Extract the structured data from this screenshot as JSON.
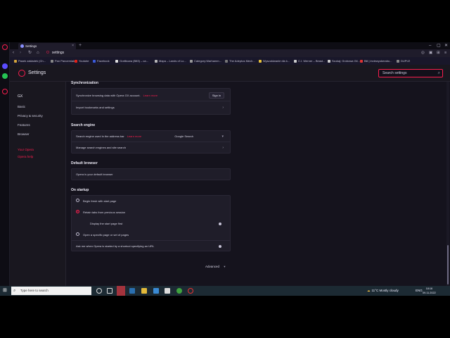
{
  "browser": {
    "tab_title": "Settings",
    "address": "settings",
    "bookmarks": [
      "Pasek zakładek (Ch...",
      "Pan Pancerniak",
      "Youtube",
      "Facebook",
      "Grafikowa (B83) – ca...",
      "Mapa – Lands of Lo...",
      "Category:Warhamm...",
      "The Adeptus Mech...",
      "Wyszukiwanie dla k...",
      "C.I. Werner – Beast...",
      "Szukaj: Grobowa Gil...",
      "Bill | inviewyokerabu...",
      "DUPLE"
    ]
  },
  "settings": {
    "page_title": "Settings",
    "search_placeholder": "Search settings",
    "nav": {
      "section": "GX",
      "items": [
        "Basic",
        "Privacy & security",
        "Features",
        "Browser"
      ],
      "links": [
        "Your Opera",
        "Opera help"
      ]
    },
    "synchronization": {
      "title": "Synchronization",
      "sync_text": "Synchronize browsing data with Opera GX account.",
      "learn_more": "Learn more",
      "sign_in": "Sign in",
      "import": "Import bookmarks and settings"
    },
    "search_engine": {
      "title": "Search engine",
      "label": "Search engine used in the address bar",
      "learn_more": "Learn more",
      "value": "Google Search",
      "manage": "Manage search engines and site search"
    },
    "default_browser": {
      "title": "Default browser",
      "text": "Opera is your default browser"
    },
    "on_startup": {
      "title": "On startup",
      "opt_fresh": "Begin fresh with start page",
      "opt_retain": "Retain tabs from previous session",
      "sub_display": "Display the start page first",
      "opt_specific": "Open a specific page or set of pages",
      "ask": "Ask me when Opera is started by a shortcut specifying an URL"
    },
    "advanced": "Advanced"
  },
  "taskbar": {
    "search_placeholder": "Type here to search",
    "weather": "11°C  Mostly cloudy",
    "lang": "ENG",
    "time": "18:16",
    "date": "09.11.2022"
  },
  "colors": {
    "accent": "#fa1e4e",
    "bg": "#15131d",
    "card": "#1f1d29"
  }
}
